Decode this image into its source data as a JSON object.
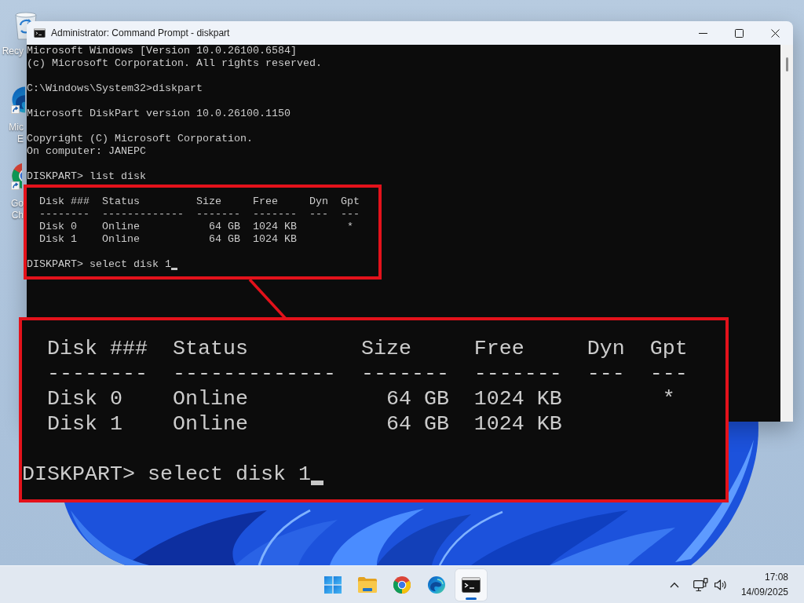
{
  "desktop": {
    "icons": [
      {
        "kind": "recycle-bin",
        "shortcut": false,
        "label_lines": [
          "Recy"
        ]
      },
      {
        "kind": "edge",
        "shortcut": true,
        "label_lines": [
          "Mic",
          "E"
        ]
      },
      {
        "kind": "chrome",
        "shortcut": true,
        "label_lines": [
          "Go",
          "Ch"
        ]
      }
    ]
  },
  "window": {
    "title": "Administrator: Command Prompt - diskpart",
    "console": {
      "cursor": true,
      "blocks": [
        {
          "highlighted": false,
          "lines": [
            "Microsoft Windows [Version 10.0.26100.6584]",
            "(c) Microsoft Corporation. All rights reserved."
          ]
        },
        {
          "highlighted": false,
          "lines": [
            "C:\\Windows\\System32>diskpart"
          ]
        },
        {
          "highlighted": false,
          "lines": [
            "Microsoft DiskPart version 10.0.26100.1150"
          ]
        },
        {
          "highlighted": false,
          "lines": [
            "Copyright (C) Microsoft Corporation.",
            "On computer: JANEPC"
          ]
        },
        {
          "highlighted": false,
          "lines": [
            "DISKPART> list disk"
          ]
        },
        {
          "highlighted": true,
          "lines": [
            "  Disk ###  Status         Size     Free     Dyn  Gpt",
            "  --------  -------------  -------  -------  ---  ---",
            "  Disk 0    Online           64 GB  1024 KB        *",
            "  Disk 1    Online           64 GB  1024 KB"
          ]
        },
        {
          "highlighted": true,
          "lines": [
            "DISKPART> select disk 1"
          ]
        }
      ]
    }
  },
  "zoom_callout": {
    "cursor": true,
    "blocks": [
      {
        "lines": [
          "  Disk ###  Status         Size     Free     Dyn  Gpt",
          "  --------  -------------  -------  -------  ---  ---",
          "  Disk 0    Online           64 GB  1024 KB        *",
          "  Disk 1    Online           64 GB  1024 KB"
        ]
      },
      {
        "lines": [
          "DISKPART> select disk 1"
        ]
      }
    ]
  },
  "taskbar": {
    "apps": [
      {
        "kind": "start",
        "selected": false
      },
      {
        "kind": "file-explorer",
        "selected": false
      },
      {
        "kind": "chrome",
        "selected": false
      },
      {
        "kind": "edge",
        "selected": false
      },
      {
        "kind": "terminal",
        "selected": true
      }
    ],
    "tray_icons": [
      {
        "kind": "chevron"
      },
      {
        "kind": "network"
      },
      {
        "kind": "volume"
      }
    ],
    "clock": {
      "time": "17:08",
      "date": "14/09/2025"
    }
  }
}
